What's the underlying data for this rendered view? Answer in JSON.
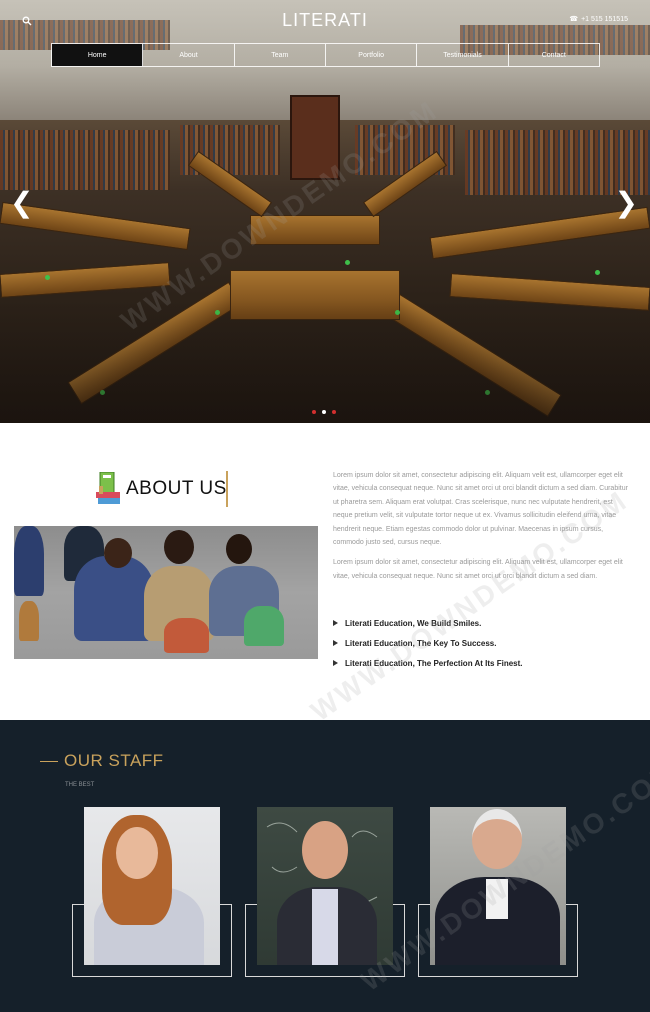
{
  "header": {
    "logo": "LITERATI",
    "phone": "+1 515 151515",
    "nav": [
      "Home",
      "About",
      "Team",
      "Portfolio",
      "Testimonials",
      "Contact"
    ],
    "active_nav": "Home"
  },
  "slider": {
    "prev_symbol": "❮",
    "next_symbol": "❯",
    "dots": 3,
    "active_dot": 2
  },
  "about": {
    "title": "ABOUT US",
    "paragraph1": "Lorem ipsum dolor sit amet, consectetur adipiscing elit. Aliquam velit est, ullamcorper eget elit vitae, vehicula consequat neque. Nunc sit amet orci ut orci blandit dictum a sed diam. Curabitur ut pharetra sem. Aliquam erat volutpat. Cras scelerisque, nunc nec vulputate hendrerit, est neque pretium velit, sit vulputate tortor neque ut ex. Vivamus sollicitudin eleifend urna, vitae hendrerit neque. Etiam egestas commodo dolor ut pulvinar. Maecenas in ipsum cursus, commodo justo sed, cursus neque.",
    "paragraph2": "Lorem ipsum dolor sit amet, consectetur adipiscing elit. Aliquam velit est, ullamcorper eget elit vitae, vehicula consequat neque. Nunc sit amet orci ut orci blandit dictum a sed diam.",
    "list": [
      "Literati Education, We Build Smiles.",
      "Literati Education, The Key To Success.",
      "Literati Education, The Perfection At Its Finest."
    ]
  },
  "staff": {
    "title": "OUR STAFF",
    "subtitle": "THE BEST"
  },
  "watermark": "WWW.DOWNDEMO.COM",
  "colors": {
    "accent": "#c9a25c",
    "staff_bg": "#15202a",
    "active_nav": "#111111"
  }
}
